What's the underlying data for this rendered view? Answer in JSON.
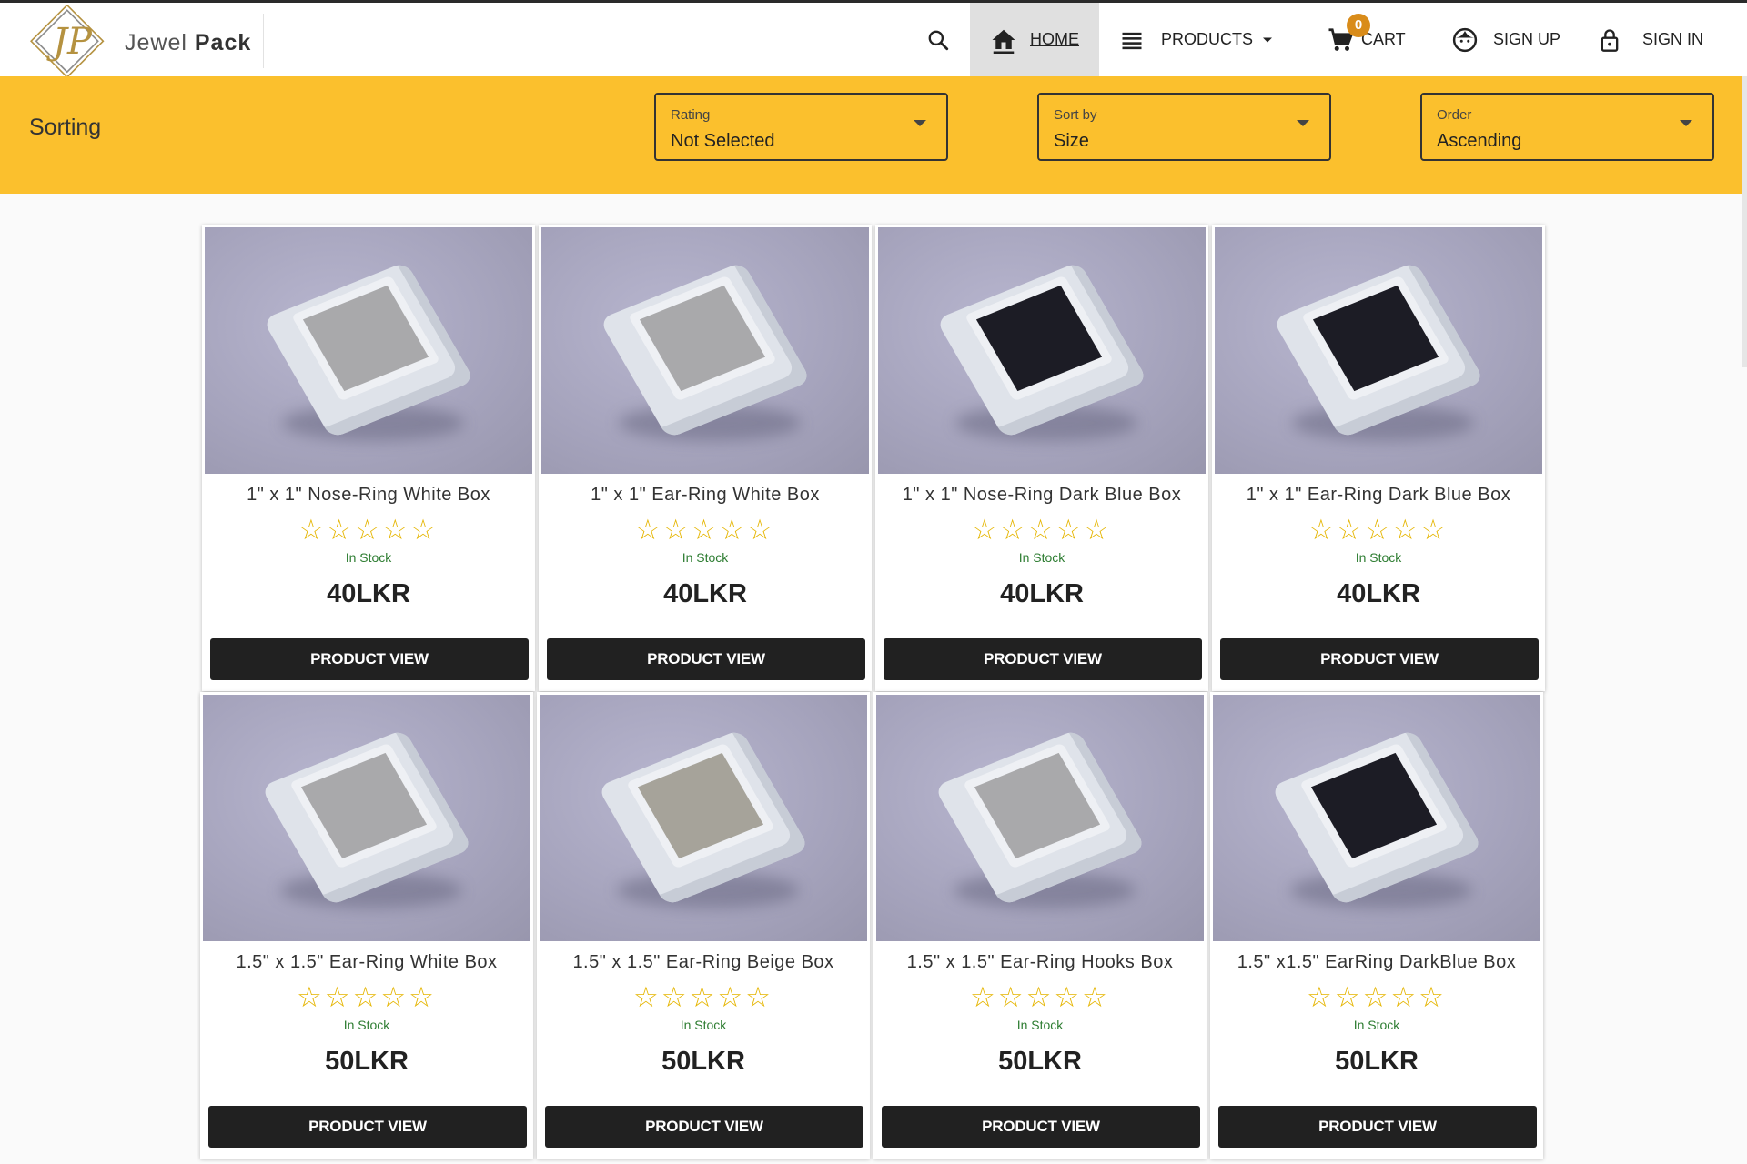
{
  "brand": {
    "name_light": "Jewel ",
    "name_bold": "Pack"
  },
  "nav": {
    "home": "HOME",
    "products": "PRODUCTS",
    "cart": "CART",
    "cart_count": "0",
    "signup": "SIGN UP",
    "signin": "SIGN IN"
  },
  "sorting": {
    "title": "Sorting",
    "rating": {
      "label": "Rating",
      "value": "Not Selected"
    },
    "sortby": {
      "label": "Sort by",
      "value": "Size"
    },
    "order": {
      "label": "Order",
      "value": "Ascending"
    }
  },
  "products": [
    {
      "name": "1\" x 1\" Nose-Ring White Box",
      "rating": 0,
      "stock": "In Stock",
      "price": "40LKR",
      "button": "PRODUCT VIEW",
      "insert": "grey"
    },
    {
      "name": "1\" x 1\" Ear-Ring White Box",
      "rating": 0,
      "stock": "In Stock",
      "price": "40LKR",
      "button": "PRODUCT VIEW",
      "insert": "grey"
    },
    {
      "name": "1\" x 1\" Nose-Ring Dark Blue Box",
      "rating": 0,
      "stock": "In Stock",
      "price": "40LKR",
      "button": "PRODUCT VIEW",
      "insert": "dark"
    },
    {
      "name": "1\" x 1\" Ear-Ring Dark Blue Box",
      "rating": 0,
      "stock": "In Stock",
      "price": "40LKR",
      "button": "PRODUCT VIEW",
      "insert": "dark"
    },
    {
      "name": "1.5\" x 1.5\" Ear-Ring White Box",
      "rating": 0,
      "stock": "In Stock",
      "price": "50LKR",
      "button": "PRODUCT VIEW",
      "insert": "grey"
    },
    {
      "name": "1.5\" x 1.5\" Ear-Ring Beige Box",
      "rating": 0,
      "stock": "In Stock",
      "price": "50LKR",
      "button": "PRODUCT VIEW",
      "insert": "beige"
    },
    {
      "name": "1.5\" x 1.5\" Ear-Ring Hooks Box",
      "rating": 0,
      "stock": "In Stock",
      "price": "50LKR",
      "button": "PRODUCT VIEW",
      "insert": "grey"
    },
    {
      "name": "1.5\" x1.5\" EarRing DarkBlue Box",
      "rating": 0,
      "stock": "In Stock",
      "price": "50LKR",
      "button": "PRODUCT VIEW",
      "insert": "dark"
    }
  ],
  "colors": {
    "accent": "#fbc02d",
    "button": "#212121",
    "star": "#e5b500",
    "stock": "#2e7d32",
    "badge": "#d98c1a"
  },
  "icons": {
    "search": "search-icon",
    "home": "home-icon",
    "menu": "menu-icon",
    "cart": "cart-icon",
    "signup": "face-icon",
    "signin": "lock-icon"
  }
}
